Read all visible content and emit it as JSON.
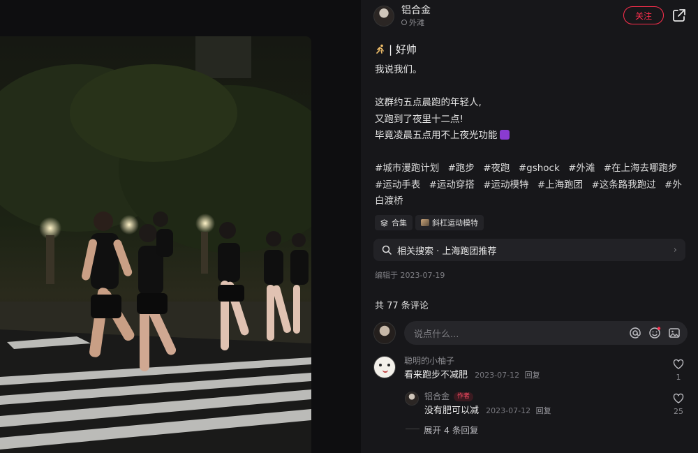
{
  "author": {
    "name": "铝合金",
    "location": "外滩"
  },
  "actions": {
    "follow_label": "关注"
  },
  "note": {
    "title": "| 好帅",
    "body": [
      "我说我们。",
      "",
      "这群约五点晨跑的年轻人,",
      "又跑到了夜里十二点!",
      "毕竟凌晨五点用不上夜光功能"
    ],
    "tags": [
      "#城市漫跑计划",
      "#跑步",
      "#夜跑",
      "#gshock",
      "#外滩",
      "#在上海去哪跑步",
      "#运动手表",
      "#运动穿搭",
      "#运动模特",
      "#上海跑团",
      "#这条路我跑过",
      "#外白渡桥"
    ],
    "chips": {
      "collection": "合集",
      "related_note": "斜杠运动模特"
    },
    "related_search": "相关搜索 · 上海跑团推荐",
    "edited": "编辑于 2023-07-19"
  },
  "comments_section": {
    "count_label": "共 77 条评论",
    "input_placeholder": "说点什么...",
    "comments": [
      {
        "user": "聪明的小柚子",
        "text": "看来跑步不减肥",
        "date": "2023-07-12",
        "reply_label": "回复",
        "likes": "1"
      }
    ],
    "replies": [
      {
        "user": "铝合金",
        "badge": "作者",
        "text": "没有肥可以减",
        "date": "2023-07-12",
        "reply_label": "回复",
        "likes": "25"
      }
    ],
    "expand_label": "展开 4 条回复"
  },
  "colors": {
    "accent": "#ff2e4d",
    "panel": "#17171a",
    "input": "#26262a"
  },
  "icons": [
    "share-icon",
    "runner-icon",
    "location-icon",
    "layers-icon",
    "search-icon",
    "chevron-right-icon",
    "at-icon",
    "emoji-icon",
    "image-icon",
    "heart-icon"
  ]
}
